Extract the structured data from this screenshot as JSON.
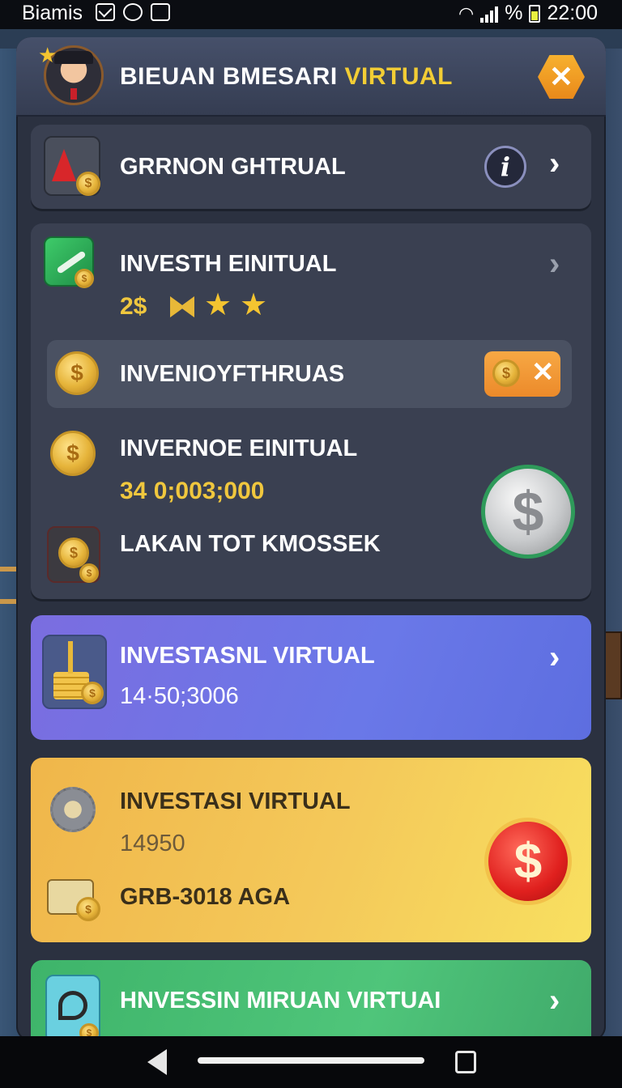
{
  "status_bar": {
    "carrier": "Biamis",
    "percent_symbol": "%",
    "time": "22:00"
  },
  "header": {
    "title_part1": "BIEUAN BMESARI ",
    "title_highlight": "VIRTUAL",
    "close_label": "✕"
  },
  "rows": {
    "row1": {
      "label": "GRRNON GHTRUAL",
      "info_label": "i",
      "chevron": "›"
    },
    "row2": {
      "label": "INVESTH EINITUAL",
      "price": "2$",
      "chevron": "›"
    },
    "bar": {
      "label": "INVENIOYFTHRUAS",
      "close_label": "✕"
    },
    "row3": {
      "label": "INVERNOE EINITUAL",
      "amount": "34 0;003;000"
    },
    "row4": {
      "label": "LAKAN TOT KMOSSEK"
    },
    "silver_coin": "$"
  },
  "cards": {
    "blue": {
      "title": "INVESTASNL VIRTUAL",
      "value": "14·50;3006",
      "chevron": "›"
    },
    "yellow": {
      "title": "INVESTASI VIRTUAL",
      "value": "14950",
      "code": "GRB-3018 AGA",
      "button": "$"
    },
    "green": {
      "title": "HNVESSIN MIRUAN VIRTUAI",
      "chevron": "›"
    }
  },
  "colors": {
    "accent_gold": "#f2cd35",
    "blue_card": "#6a78e8",
    "yellow_card": "#f4c95a",
    "green_card": "#4fc57a",
    "red_button": "#e0201e"
  }
}
